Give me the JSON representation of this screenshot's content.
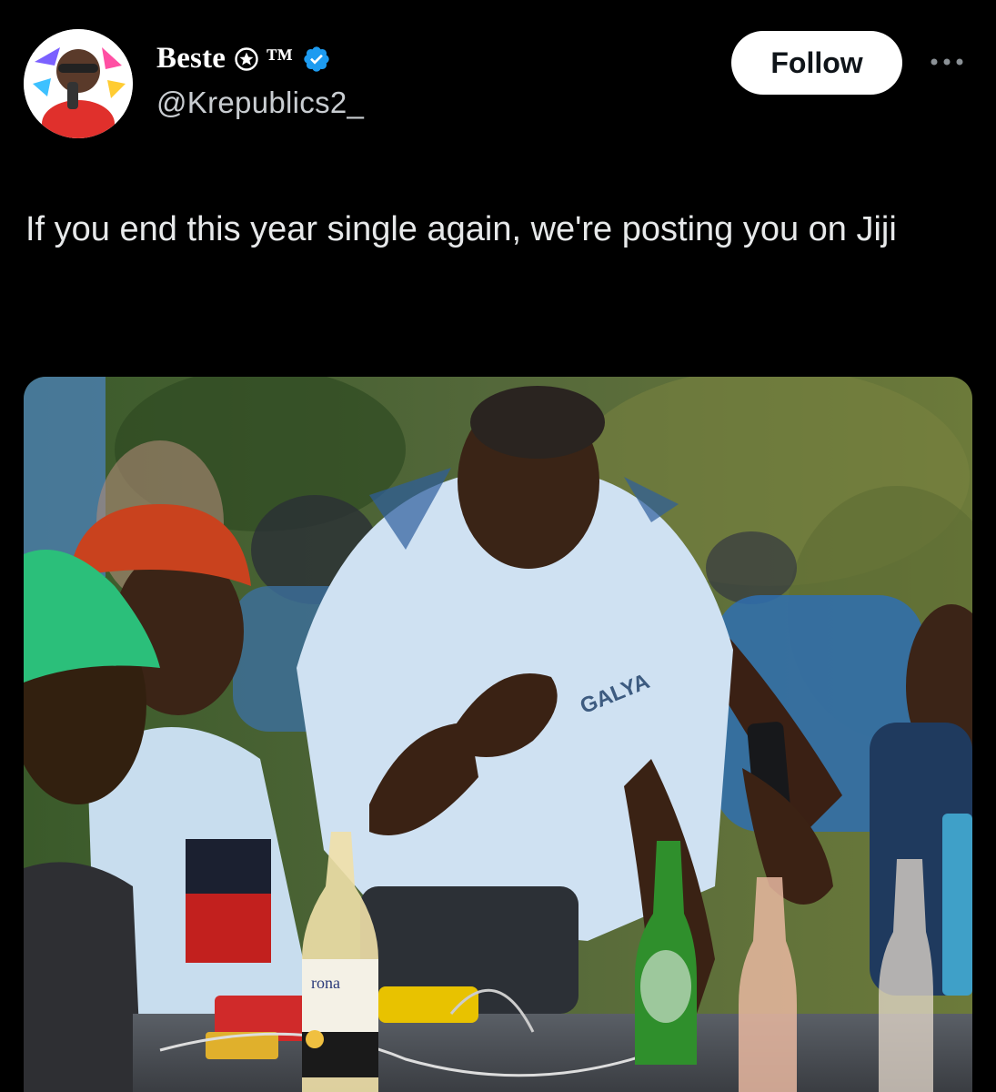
{
  "post": {
    "author": {
      "display_name": "Beste",
      "name_suffix": "™",
      "handle": "@Krepublics2_",
      "verified": true
    },
    "follow_label": "Follow",
    "text": "If you end this year single again, we're posting you on Jiji"
  },
  "media": {
    "photo_text": {
      "shirt_print": "GALYA",
      "bottle_label": "rona"
    }
  },
  "icons": {
    "verified": "verified-badge-icon",
    "star": "star-icon",
    "more": "more-options-icon"
  },
  "colors": {
    "background": "#000000",
    "text_primary": "#e7e9ea",
    "text_secondary": "#c9cdd1",
    "verified_blue": "#1d9bf0",
    "follow_bg": "#ffffff"
  }
}
